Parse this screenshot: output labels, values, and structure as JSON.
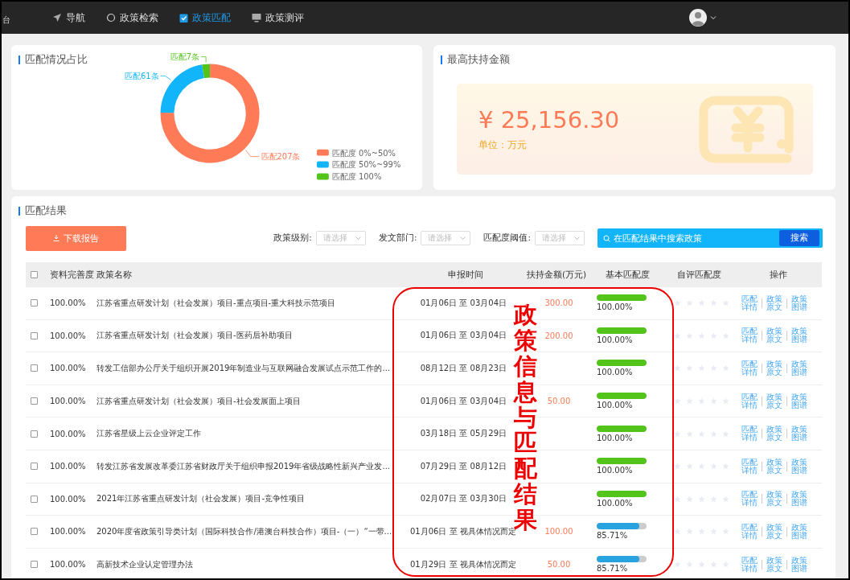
{
  "nav": {
    "edge_text": "台",
    "items": [
      {
        "label": "导航",
        "selected": false
      },
      {
        "label": "政策检索",
        "selected": false
      },
      {
        "label": "政策匹配",
        "selected": true
      },
      {
        "label": "政策测评",
        "selected": false
      }
    ]
  },
  "match_ratio": {
    "title": "匹配情况占比",
    "chart_data": {
      "type": "donut",
      "categories": [
        "匹配度 0%~50%",
        "匹配度 50%~99%",
        "匹配度 100%"
      ],
      "values": [
        207,
        61,
        7
      ],
      "colors": [
        "#ff7a57",
        "#12b5fa",
        "#52c41a"
      ],
      "value_labels": [
        "匹配207条",
        "匹配61条",
        "匹配7条"
      ],
      "legend": "bottom-right"
    }
  },
  "max_support": {
    "title": "最高扶持金额",
    "amount": "¥ 25,156.30",
    "unit": "单位：万元"
  },
  "results": {
    "title": "匹配结果",
    "download_button": "下载报告",
    "filters": [
      {
        "label": "政策级别:",
        "placeholder": "请选择"
      },
      {
        "label": "发文部门:",
        "placeholder": "请选择"
      },
      {
        "label": "匹配度阈值:",
        "placeholder": "请选择"
      }
    ],
    "search": {
      "placeholder": "在匹配结果中搜索政策",
      "button": "搜索"
    },
    "header_checked": false,
    "columns": [
      "资料完善度",
      "政策名称",
      "申报时间",
      "扶持金额(万元)",
      "基本匹配度",
      "自评匹配度",
      "操作"
    ],
    "rows": [
      {
        "checked": false,
        "completeness": "100.00%",
        "name": "江苏省重点研发计划（社会发展）项目-重点项目-重大科技示范项目",
        "period": "01月06日 至 03月04日",
        "amount": "300.00",
        "level": 1,
        "match": "100.00%",
        "stars": 0,
        "actions": [
          "匹配详情",
          "政策原文",
          "政策图谱"
        ]
      },
      {
        "checked": false,
        "completeness": "100.00%",
        "name": "江苏省重点研发计划（社会发展）项目-医药后补助项目",
        "period": "01月06日 至 03月04日",
        "amount": "200.00",
        "level": 1,
        "match": "100.00%",
        "stars": 0,
        "actions": [
          "匹配详情",
          "政策原文",
          "政策图谱"
        ]
      },
      {
        "checked": false,
        "completeness": "100.00%",
        "name": "转发工信部办公厅关于组织开展2019年制造业与互联网融合发展试点示范工作的...",
        "period": "08月12日 至 08月23日",
        "level": 1,
        "match": "100.00%",
        "stars": 0,
        "actions": [
          "匹配详情",
          "政策原文",
          "政策图谱"
        ]
      },
      {
        "checked": false,
        "completeness": "100.00%",
        "name": "江苏省重点研发计划（社会发展）项目-社会发展面上项目",
        "period": "01月06日 至 03月04日",
        "amount": "50.00",
        "level": 1,
        "match": "100.00%",
        "stars": 0,
        "actions": [
          "匹配详情",
          "政策原文",
          "政策图谱"
        ]
      },
      {
        "checked": false,
        "completeness": "100.00%",
        "name": "江苏省星级上云企业评定工作",
        "period": "03月18日 至 05月29日",
        "level": 1,
        "match": "100.00%",
        "stars": 0,
        "actions": [
          "匹配详情",
          "政策原文",
          "政策图谱"
        ]
      },
      {
        "checked": false,
        "completeness": "100.00%",
        "name": "转发江苏省发展改革委江苏省财政厅关于组织申报2019年省级战略性新兴产业发...",
        "period": "07月29日 至 08月12日",
        "level": 1,
        "match": "100.00%",
        "stars": 0,
        "actions": [
          "匹配详情",
          "政策原文",
          "政策图谱"
        ]
      },
      {
        "checked": false,
        "completeness": "100.00%",
        "name": "2021年江苏省重点研发计划（社会发展）项目-竞争性项目",
        "period": "02月07日 至 03月30日",
        "level": 1,
        "match": "100.00%",
        "stars": 0,
        "actions": [
          "匹配详情",
          "政策原文",
          "政策图谱"
        ]
      },
      {
        "checked": false,
        "completeness": "100.00%",
        "name": "2020年度省政策引导类计划（国际科技合作/港澳台科技合作）项目-（一）“一带...",
        "period": "01月06日 至 视具体情况而定",
        "amount": "100.00",
        "level": 0.8571,
        "match": "85.71%",
        "stars": 0,
        "actions": [
          "匹配详情",
          "政策原文",
          "政策图谱"
        ]
      },
      {
        "checked": false,
        "completeness": "100.00%",
        "name": "高新技术企业认定管理办法",
        "period": "01月29日 至 视具体情况而定",
        "amount": "50.00",
        "level": 0.8571,
        "match": "85.71%",
        "stars": 0,
        "actions": [
          "匹配详情",
          "政策原文",
          "政策图谱"
        ]
      }
    ]
  },
  "annotation": {
    "text": "政策信息与匹配结果"
  }
}
